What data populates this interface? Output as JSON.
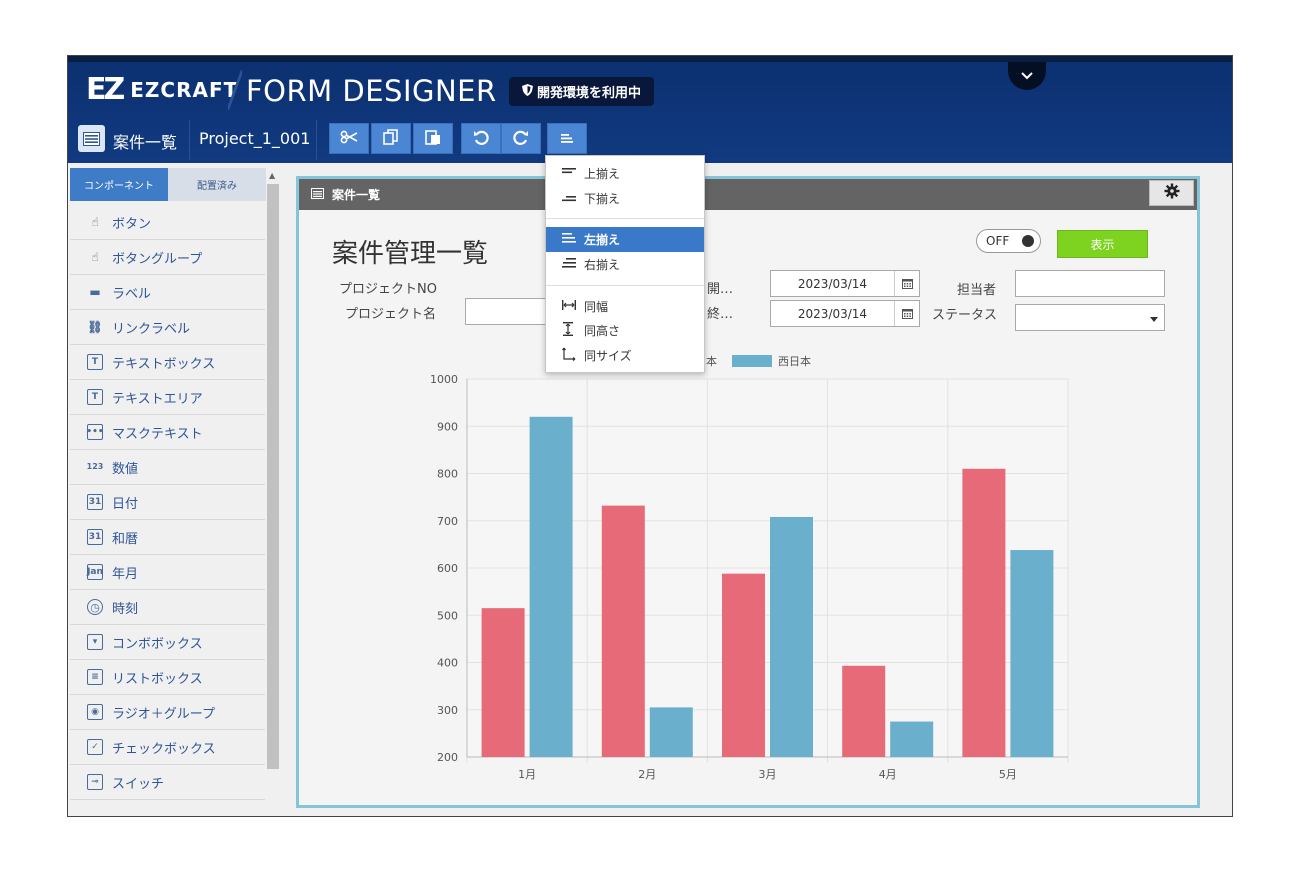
{
  "header": {
    "logo_mark": "EZ",
    "logo_text": "EZCRAFT",
    "app_title": "FORM DESIGNER",
    "env_badge": "開発環境を利用中"
  },
  "toolbar": {
    "form_name": "案件一覧",
    "project_name": "Project_1_001",
    "buttons": [
      "scissors-icon",
      "copy-icon",
      "paste-icon",
      "undo-icon",
      "redo-icon",
      "align-icon"
    ]
  },
  "left_panel": {
    "tabs": [
      "コンポーネント",
      "配置済み"
    ],
    "components": [
      {
        "label": "ボタン",
        "icon": "pointer"
      },
      {
        "label": "ボタングループ",
        "icon": "pointer"
      },
      {
        "label": "ラベル",
        "icon": "tag"
      },
      {
        "label": "リンクラベル",
        "icon": "link"
      },
      {
        "label": "テキストボックス",
        "icon": "T"
      },
      {
        "label": "テキストエリア",
        "icon": "T"
      },
      {
        "label": "マスクテキスト",
        "icon": "•••"
      },
      {
        "label": "数値",
        "icon": "123"
      },
      {
        "label": "日付",
        "icon": "31"
      },
      {
        "label": "和暦",
        "icon": "31"
      },
      {
        "label": "年月",
        "icon": "Jan"
      },
      {
        "label": "時刻",
        "icon": "clock"
      },
      {
        "label": "コンボボックス",
        "icon": "▾"
      },
      {
        "label": "リストボックス",
        "icon": "≡"
      },
      {
        "label": "ラジオ＋グループ",
        "icon": "◉"
      },
      {
        "label": "チェックボックス",
        "icon": "✓"
      },
      {
        "label": "スイッチ",
        "icon": "switch"
      }
    ]
  },
  "form": {
    "titlebar": "案件一覧",
    "heading": "案件管理一覧",
    "toggle_label": "OFF",
    "show_button": "表示",
    "fields": {
      "project_no_label": "プロジェクトNO",
      "project_name_label": "プロジェクト名",
      "start_label": "開…",
      "end_label": "終…",
      "start_date": "2023/03/14",
      "end_date": "2023/03/14",
      "person_label": "担当者",
      "status_label": "ステータス"
    }
  },
  "align_menu": {
    "items": [
      {
        "label": "上揃え",
        "selected": false
      },
      {
        "label": "下揃え",
        "selected": false
      },
      {
        "label": "左揃え",
        "selected": true
      },
      {
        "label": "右揃え",
        "selected": false
      },
      {
        "label": "同幅",
        "selected": false
      },
      {
        "label": "同高さ",
        "selected": false
      },
      {
        "label": "同サイズ",
        "selected": false
      }
    ]
  },
  "chart_data": {
    "type": "bar",
    "categories": [
      "1月",
      "2月",
      "3月",
      "4月",
      "5月"
    ],
    "series": [
      {
        "name": "東日本",
        "values": [
          515,
          732,
          588,
          393,
          810
        ],
        "color": "#e66a78"
      },
      {
        "name": "西日本",
        "values": [
          920,
          305,
          708,
          275,
          638
        ],
        "color": "#6ab0cc"
      }
    ],
    "ylim": [
      200,
      1000
    ],
    "yticks": [
      200,
      300,
      400,
      500,
      600,
      700,
      800,
      900,
      1000
    ],
    "legend_position": "top"
  }
}
